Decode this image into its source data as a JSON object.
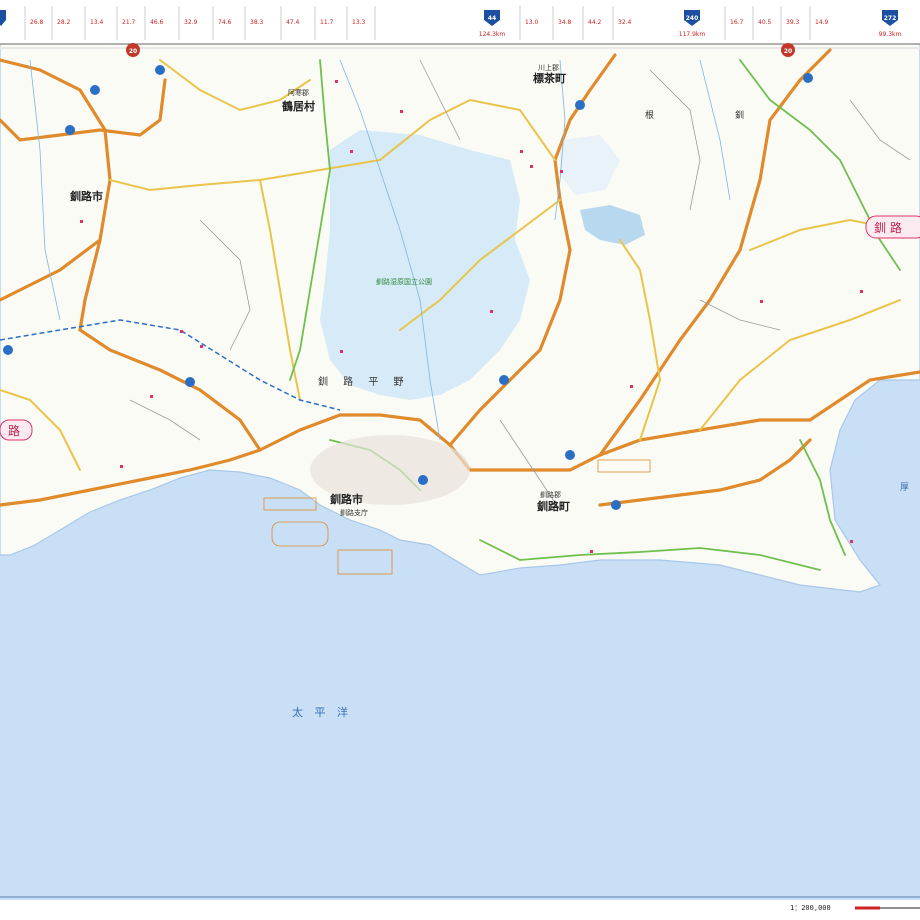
{
  "map": {
    "ocean_label": "太 平 洋",
    "scale": "1：200,000",
    "cities": [
      {
        "name": "釧路市"
      },
      {
        "name": "鶴居村",
        "sub": "阿寒郡"
      },
      {
        "name": "標茶町",
        "sub": "川上郡"
      },
      {
        "name": "釧路町",
        "sub": "釧路郡"
      },
      {
        "name": "釧路市",
        "sub": "釧路支庁"
      }
    ],
    "region_labels": [
      "釧 路 平 野",
      "路",
      "釧 路",
      "根",
      "釧",
      "厚"
    ],
    "park_label": "釧路湿原国立公園",
    "route_shields": [
      "44",
      "240",
      "272",
      "20"
    ],
    "top_distances": [
      "124.3km",
      "117.9km",
      "99.3km"
    ],
    "colors": {
      "sea": "#c8dff5",
      "land": "#fbfbf6",
      "national_road": "#e08a2c",
      "prefectural_road": "#e9c44a",
      "minor_road": "#6fbf4c",
      "wetland": "#cfe6f7",
      "rail": "#3a3a3a"
    }
  }
}
